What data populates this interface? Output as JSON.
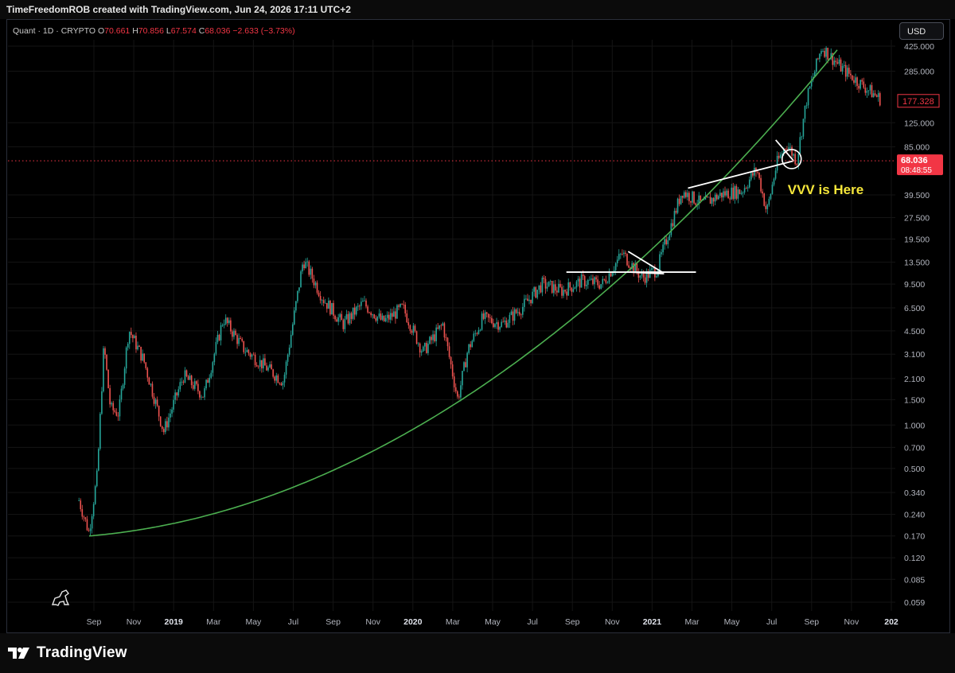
{
  "header": {
    "credit": "TimeFreedomROB created with TradingView.com, Jun 24, 2026 17:11 UTC+2"
  },
  "legend": {
    "symbol": "Quant · 1D · CRYPTO",
    "o_label": "O",
    "o_value": "70.661",
    "h_label": "H",
    "h_value": "70.856",
    "l_label": "L",
    "l_value": "67.574",
    "c_label": "C",
    "c_value": "68.036",
    "change": "−2.633 (−3.73%)"
  },
  "currency_button": "USD",
  "brand": {
    "name": "TradingView"
  },
  "colors": {
    "background": "#000000",
    "candle_up": "#26a69a",
    "candle_down": "#ef5350",
    "trend_curve": "#4caf50",
    "drawing": "#ffffff",
    "annotation": "#f5e63a",
    "price_line": "#f23645"
  },
  "chart_data": {
    "type": "candlestick",
    "title": "Quant · 1D · CRYPTO",
    "scale": "log",
    "y_axis_ticks": [
      "425.000",
      "285.000",
      "125.000",
      "85.000",
      "39.500",
      "27.500",
      "19.500",
      "13.500",
      "9.500",
      "6.500",
      "4.500",
      "3.100",
      "2.100",
      "1.500",
      "1.000",
      "0.700",
      "0.500",
      "0.340",
      "0.240",
      "0.170",
      "0.120",
      "0.085",
      "0.059"
    ],
    "x_axis_ticks": [
      "Sep",
      "Nov",
      "2019",
      "Mar",
      "May",
      "Jul",
      "Sep",
      "Nov",
      "2020",
      "Mar",
      "May",
      "Jul",
      "Sep",
      "Nov",
      "2021",
      "Mar",
      "May",
      "Jul",
      "Sep",
      "Nov",
      "202"
    ],
    "current_price_label": "68.036",
    "countdown_label": "08:48:55",
    "last_price_label": "177.328",
    "annotation": "VVV is Here",
    "ylim": [
      0.05,
      500
    ],
    "price_path": [
      [
        "Aug 2018",
        0.3
      ],
      [
        "Aug 2018",
        0.18
      ],
      [
        "Sep 2018",
        0.45
      ],
      [
        "Sep 2018",
        3.6
      ],
      [
        "Sep 2018",
        1.3
      ],
      [
        "Oct 2018",
        1.2
      ],
      [
        "Oct 2018",
        4.6
      ],
      [
        "Nov 2018",
        2.8
      ],
      [
        "Dec 2018",
        0.9
      ],
      [
        "Jan 2019",
        2.2
      ],
      [
        "Feb 2019",
        1.6
      ],
      [
        "Mar 2019",
        5.5
      ],
      [
        "Apr 2019",
        3.4
      ],
      [
        "May 2019",
        2.6
      ],
      [
        "Jun 2019",
        2.0
      ],
      [
        "Jul 2019",
        14.0
      ],
      [
        "Aug 2019",
        7.5
      ],
      [
        "Sep 2019",
        5.0
      ],
      [
        "Oct 2019",
        7.0
      ],
      [
        "Nov 2019",
        5.2
      ],
      [
        "Dec 2019",
        6.5
      ],
      [
        "Jan 2020",
        3.2
      ],
      [
        "Feb 2020",
        5.0
      ],
      [
        "Mar 2020",
        1.5
      ],
      [
        "Mar 2020",
        3.3
      ],
      [
        "Apr 2020",
        5.5
      ],
      [
        "May 2020",
        5.0
      ],
      [
        "Jun 2020",
        6.6
      ],
      [
        "Jul 2020",
        9.5
      ],
      [
        "Aug 2020",
        8.5
      ],
      [
        "Sep 2020",
        10.0
      ],
      [
        "Oct 2020",
        9.5
      ],
      [
        "Nov 2020",
        15.5
      ],
      [
        "Dec 2020",
        10.5
      ],
      [
        "Jan 2021",
        12.0
      ],
      [
        "Jan 2021",
        20.0
      ],
      [
        "Feb 2021",
        42.0
      ],
      [
        "Mar 2021",
        34.0
      ],
      [
        "Apr 2021",
        40.0
      ],
      [
        "May 2021",
        42.0
      ],
      [
        "Jun 2021",
        60.0
      ],
      [
        "Jun 2021",
        30.0
      ],
      [
        "Jul 2021",
        65.0
      ],
      [
        "Jul 2021",
        90.0
      ],
      [
        "Aug 2021",
        68.0
      ],
      [
        "Aug 2021",
        180.0
      ],
      [
        "Sep 2021",
        420.0
      ],
      [
        "Oct 2021",
        300.0
      ],
      [
        "Nov 2021",
        230.0
      ],
      [
        "Dec 2021",
        180.0
      ]
    ]
  }
}
